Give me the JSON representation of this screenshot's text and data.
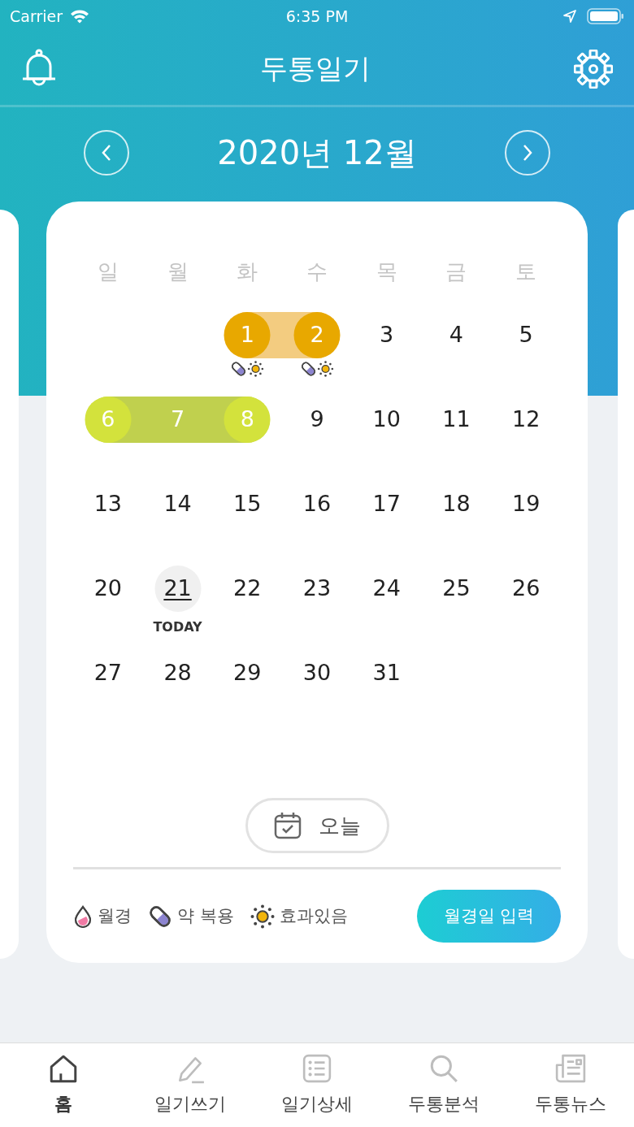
{
  "status_bar": {
    "carrier": "Carrier",
    "time": "6:35 PM"
  },
  "header": {
    "title": "두통일기"
  },
  "month_nav": {
    "title": "2020년 12월"
  },
  "calendar": {
    "weekdays": [
      "일",
      "월",
      "화",
      "수",
      "목",
      "금",
      "토"
    ],
    "weeks": [
      {
        "days": [
          {
            "kind": "empty"
          },
          {
            "kind": "empty"
          },
          {
            "kind": "circle",
            "day": "1",
            "color": "#e8a800",
            "band": {
              "kind": "start",
              "color": "#f3cc80"
            },
            "pill": true,
            "sun": true
          },
          {
            "kind": "circle",
            "day": "2",
            "color": "#e8a800",
            "band": {
              "kind": "end",
              "color": "#f3cc80"
            },
            "pill": true,
            "sun": true
          },
          {
            "kind": "plain",
            "day": "3"
          },
          {
            "kind": "plain",
            "day": "4"
          },
          {
            "kind": "plain",
            "day": "5"
          }
        ]
      },
      {
        "days": [
          {
            "kind": "circle",
            "day": "6",
            "color": "#d3e23c",
            "band": {
              "kind": "start",
              "color": "#c0d04e"
            }
          },
          {
            "kind": "band",
            "day": "7",
            "band": {
              "kind": "middle",
              "color": "#c0d04e"
            }
          },
          {
            "kind": "circle",
            "day": "8",
            "color": "#d3e23c",
            "band": {
              "kind": "end",
              "color": "#c0d04e"
            }
          },
          {
            "kind": "plain",
            "day": "9"
          },
          {
            "kind": "plain",
            "day": "10"
          },
          {
            "kind": "plain",
            "day": "11"
          },
          {
            "kind": "plain",
            "day": "12"
          }
        ]
      },
      {
        "days": [
          {
            "kind": "plain",
            "day": "13"
          },
          {
            "kind": "plain",
            "day": "14"
          },
          {
            "kind": "plain",
            "day": "15"
          },
          {
            "kind": "plain",
            "day": "16"
          },
          {
            "kind": "plain",
            "day": "17"
          },
          {
            "kind": "plain",
            "day": "18"
          },
          {
            "kind": "plain",
            "day": "19"
          }
        ]
      },
      {
        "days": [
          {
            "kind": "plain",
            "day": "20"
          },
          {
            "kind": "today",
            "day": "21",
            "label": "TODAY"
          },
          {
            "kind": "plain",
            "day": "22"
          },
          {
            "kind": "plain",
            "day": "23"
          },
          {
            "kind": "plain",
            "day": "24"
          },
          {
            "kind": "plain",
            "day": "25"
          },
          {
            "kind": "plain",
            "day": "26"
          }
        ]
      },
      {
        "days": [
          {
            "kind": "plain",
            "day": "27"
          },
          {
            "kind": "plain",
            "day": "28"
          },
          {
            "kind": "plain",
            "day": "29"
          },
          {
            "kind": "plain",
            "day": "30"
          },
          {
            "kind": "plain",
            "day": "31"
          },
          {
            "kind": "empty"
          },
          {
            "kind": "empty"
          }
        ]
      }
    ]
  },
  "today_button": {
    "label": "오늘"
  },
  "legend": [
    {
      "kind": "drop",
      "label": "월경"
    },
    {
      "kind": "pill",
      "label": "약 복용"
    },
    {
      "kind": "sun",
      "label": "효과있음"
    }
  ],
  "enter_button": {
    "label": "월경일 입력"
  },
  "tab_bar": [
    {
      "kind": "home",
      "label": "홈",
      "selected": true
    },
    {
      "kind": "pencil",
      "label": "일기쓰기",
      "selected": false
    },
    {
      "kind": "list",
      "label": "일기상세",
      "selected": false
    },
    {
      "kind": "search",
      "label": "두통분석",
      "selected": false
    },
    {
      "kind": "news",
      "label": "두통뉴스",
      "selected": false
    }
  ]
}
